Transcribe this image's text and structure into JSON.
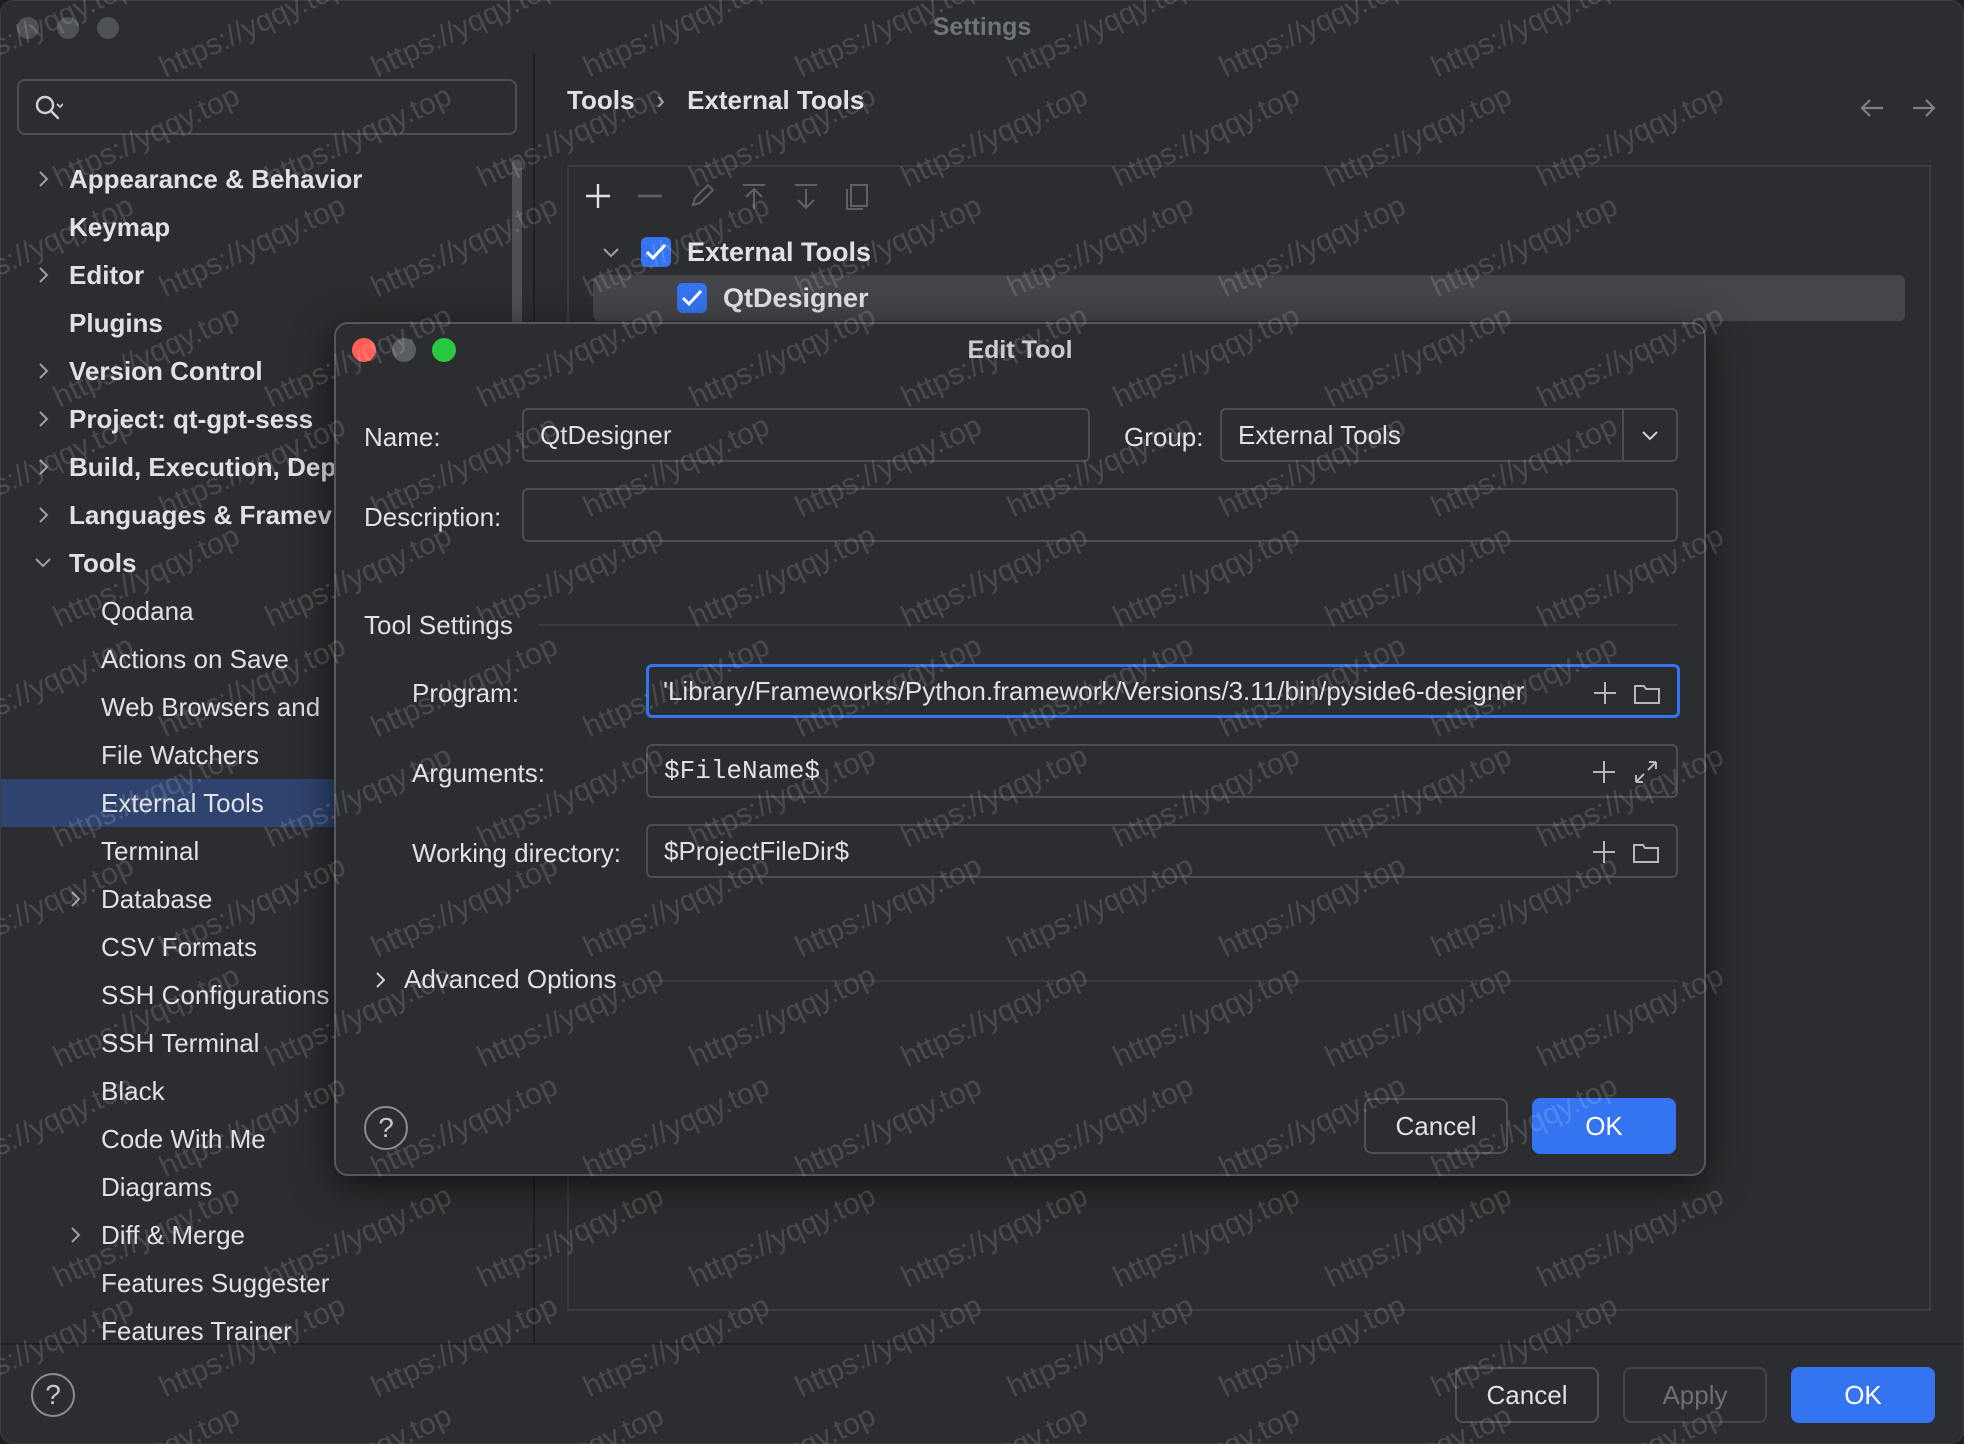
{
  "window": {
    "title": "Settings"
  },
  "search": {
    "placeholder": ""
  },
  "sidebar": {
    "items": [
      {
        "label": "Appearance & Behavior",
        "chevron": "right"
      },
      {
        "label": "Keymap",
        "chevron": ""
      },
      {
        "label": "Editor",
        "chevron": "right"
      },
      {
        "label": "Plugins",
        "chevron": ""
      },
      {
        "label": "Version Control",
        "chevron": "right"
      },
      {
        "label": "Project: qt-gpt-sess",
        "chevron": "right"
      },
      {
        "label": "Build, Execution, Dep",
        "chevron": "right"
      },
      {
        "label": "Languages & Framev",
        "chevron": "right"
      },
      {
        "label": "Tools",
        "chevron": "down"
      },
      {
        "label": "Qodana",
        "chevron": ""
      },
      {
        "label": "Actions on Save",
        "chevron": ""
      },
      {
        "label": "Web Browsers and",
        "chevron": ""
      },
      {
        "label": "File Watchers",
        "chevron": ""
      },
      {
        "label": "External Tools",
        "chevron": ""
      },
      {
        "label": "Terminal",
        "chevron": ""
      },
      {
        "label": "Database",
        "chevron": "right"
      },
      {
        "label": "CSV Formats",
        "chevron": ""
      },
      {
        "label": "SSH Configurations",
        "chevron": ""
      },
      {
        "label": "SSH Terminal",
        "chevron": ""
      },
      {
        "label": "Black",
        "chevron": ""
      },
      {
        "label": "Code With Me",
        "chevron": ""
      },
      {
        "label": "Diagrams",
        "chevron": ""
      },
      {
        "label": "Diff & Merge",
        "chevron": "right"
      },
      {
        "label": "Features Suggester",
        "chevron": ""
      },
      {
        "label": "Features Trainer",
        "chevron": ""
      }
    ],
    "selected": "External Tools"
  },
  "breadcrumb": {
    "parent": "Tools",
    "separator": "›",
    "current": "External Tools"
  },
  "tools_tree": {
    "group": {
      "label": "External Tools",
      "checked": true
    },
    "tool": {
      "label": "QtDesigner",
      "checked": true
    }
  },
  "dialog": {
    "title": "Edit Tool",
    "name_label": "Name:",
    "name_value": "QtDesigner",
    "group_label": "Group:",
    "group_value": "External Tools",
    "description_label": "Description:",
    "description_value": "",
    "tool_settings_title": "Tool Settings",
    "program_label": "Program:",
    "program_value": "'Library/Frameworks/Python.framework/Versions/3.11/bin/pyside6-designer",
    "arguments_label": "Arguments:",
    "arguments_value": "$FileName$",
    "workdir_label": "Working directory:",
    "workdir_value": "$ProjectFileDir$",
    "advanced_label": "Advanced Options",
    "help": "?",
    "cancel": "Cancel",
    "ok": "OK"
  },
  "footer": {
    "help": "?",
    "cancel": "Cancel",
    "apply": "Apply",
    "ok": "OK"
  },
  "colors": {
    "accent": "#3574f0",
    "background": "#2b2d30",
    "selection": "#2e436e",
    "close": "#ff5f57",
    "minimize": "#5a5d63",
    "zoom": "#28c840"
  },
  "watermark": "https://yqqy.top"
}
